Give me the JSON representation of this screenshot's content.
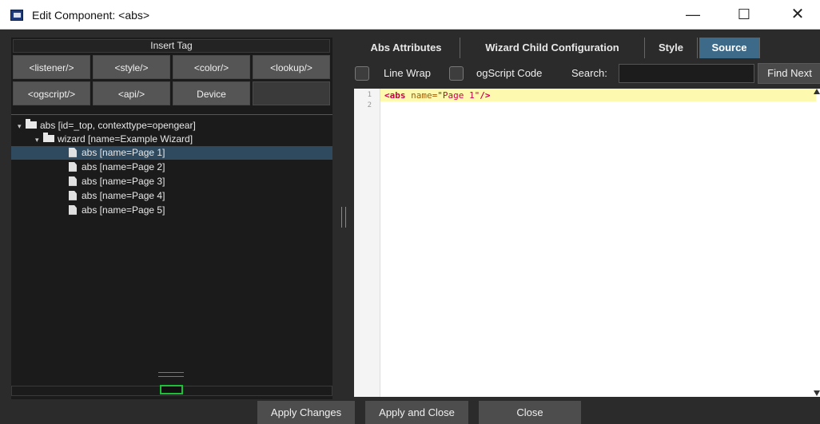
{
  "window": {
    "title": "Edit Component: <abs>",
    "minimize": "—",
    "maximize": "☐",
    "close": "✕"
  },
  "insert_tag": {
    "header": "Insert Tag",
    "buttons": [
      "<listener/>",
      "<style/>",
      "<color/>",
      "<lookup/>",
      "<ogscript/>",
      "<api/>",
      "Device"
    ]
  },
  "tree": {
    "root": "abs [id=_top, contexttype=opengear]",
    "wizard": "wizard [name=Example Wizard]",
    "pages": [
      "abs [name=Page 1]",
      "abs [name=Page 2]",
      "abs [name=Page 3]",
      "abs [name=Page 4]",
      "abs [name=Page 5]"
    ],
    "selected_index": 0
  },
  "tabs": [
    "Abs Attributes",
    "Wizard Child Configuration",
    "Style",
    "Source"
  ],
  "active_tab": "Source",
  "toolbar": {
    "line_wrap": "Line Wrap",
    "ogscript_code": "ogScript Code",
    "search_label": "Search:",
    "search_value": "",
    "find_next": "Find Next"
  },
  "editor": {
    "line_numbers": [
      "1",
      "2"
    ],
    "line1": {
      "open": "<abs",
      "attr": " name=",
      "value": "\"Page 1\"",
      "close": "/>"
    }
  },
  "footer": {
    "apply_changes": "Apply Changes",
    "apply_and_close": "Apply and Close",
    "close": "Close"
  },
  "colors": {
    "active_tab": "#3d6a89",
    "selection": "#2f4a5f",
    "highlight_line": "#fdfab0",
    "status_box": "#1fbf3a"
  }
}
